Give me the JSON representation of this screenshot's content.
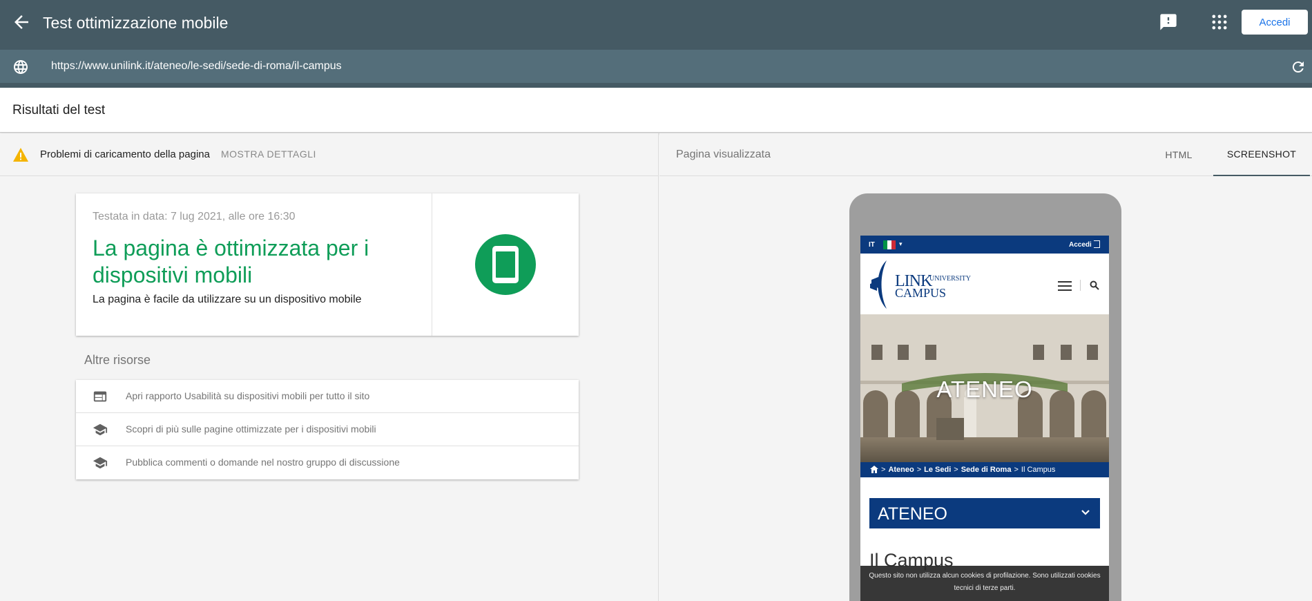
{
  "app": {
    "title": "Test ottimizzazione mobile",
    "sign_in": "Accedi"
  },
  "url_bar": {
    "url": "https://www.unilink.it/ateneo/le-sedi/sede-di-roma/il-campus"
  },
  "results": {
    "header": "Risultati del test",
    "warning_text": "Problemi di caricamento della pagina",
    "show_details": "MOSTRA DETTAGLI",
    "tested_on": "Testata in data: 7 lug 2021, alle ore 16:30",
    "verdict": "La pagina è ottimizzata per i dispositivi mobili",
    "verdict_sub": "La pagina è facile da utilizzare su un dispositivo mobile",
    "colors": {
      "success": "#0f9d58",
      "warning": "#f4b400"
    }
  },
  "resources": {
    "title": "Altre risorse",
    "items": [
      {
        "label": "Apri rapporto Usabilità su dispositivi mobili per tutto il sito",
        "icon": "web-icon"
      },
      {
        "label": "Scopri di più sulle pagine ottimizzate per i dispositivi mobili",
        "icon": "school-icon"
      },
      {
        "label": "Pubblica commenti o domande nel nostro gruppo di discussione",
        "icon": "school-icon"
      }
    ]
  },
  "preview": {
    "title": "Pagina visualizzata",
    "tabs": [
      "HTML",
      "SCREENSHOT"
    ],
    "active_tab": "SCREENSHOT"
  },
  "site": {
    "lang": "IT",
    "login": "Accedi",
    "logo_link": "LINK",
    "logo_university": "UNIVERSITY",
    "logo_campus": "CAMPUS",
    "hero_title": "ATENEO",
    "breadcrumb": [
      "Ateneo",
      "Le Sedi",
      "Sede di Roma",
      "Il Campus"
    ],
    "section_title": "ATENEO",
    "page_title": "Il Campus",
    "cookie_text": "Questo sito non utilizza alcun cookies di profilazione. Sono utilizzati cookies tecnici di terze parti.",
    "brand_color": "#0b3a7e"
  }
}
